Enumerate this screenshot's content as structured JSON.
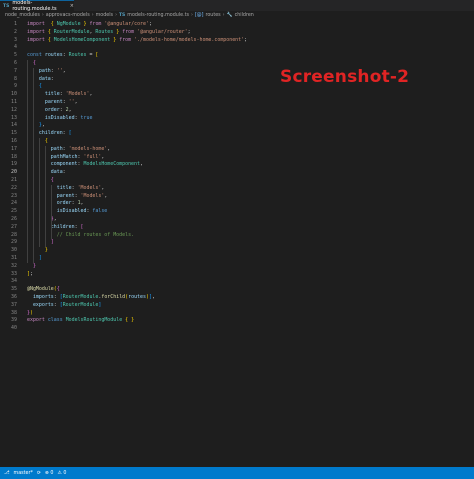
{
  "tab": {
    "icon": "TS",
    "filename": "models-routing.module.ts",
    "close": "×"
  },
  "breadcrumb": {
    "segments": [
      "node_modules",
      "approvacs-models",
      "models"
    ],
    "file_icon": "TS",
    "file": "models-routing.module.ts",
    "symbol_icon": "[@]",
    "symbol": "routes",
    "child_icon": "🔧",
    "child": "children",
    "separator": "›"
  },
  "watermark": "Screenshot-2",
  "editor": {
    "active_line": 20,
    "lines": [
      [
        [
          "kw",
          "import"
        ],
        [
          "",
          "  "
        ],
        [
          "b1",
          "{"
        ],
        [
          "",
          " "
        ],
        [
          "cls",
          "NgModule"
        ],
        [
          "",
          " "
        ],
        [
          "b1",
          "}"
        ],
        [
          "",
          " "
        ],
        [
          "kw",
          "from"
        ],
        [
          "",
          " "
        ],
        [
          "str",
          "'@angular/core'"
        ],
        [
          "",
          ";"
        ]
      ],
      [
        [
          "kw",
          "import"
        ],
        [
          "",
          " "
        ],
        [
          "b1",
          "{"
        ],
        [
          "",
          " "
        ],
        [
          "cls",
          "RouterModule"
        ],
        [
          "",
          ", "
        ],
        [
          "cls",
          "Routes"
        ],
        [
          "",
          " "
        ],
        [
          "b1",
          "}"
        ],
        [
          "",
          " "
        ],
        [
          "kw",
          "from"
        ],
        [
          "",
          " "
        ],
        [
          "str",
          "'@angular/router'"
        ],
        [
          "",
          ";"
        ]
      ],
      [
        [
          "kw",
          "import"
        ],
        [
          "",
          " "
        ],
        [
          "b1",
          "{"
        ],
        [
          "",
          " "
        ],
        [
          "cls",
          "ModelsHomeComponent"
        ],
        [
          "",
          " "
        ],
        [
          "b1",
          "}"
        ],
        [
          "",
          " "
        ],
        [
          "kw",
          "from"
        ],
        [
          "",
          " "
        ],
        [
          "str",
          "'./models-home/models-home.component'"
        ],
        [
          "",
          ";"
        ]
      ],
      [],
      [
        [
          "st",
          "const"
        ],
        [
          "",
          " "
        ],
        [
          "var",
          "routes"
        ],
        [
          "",
          ": "
        ],
        [
          "cls",
          "Routes"
        ],
        [
          "",
          " = "
        ],
        [
          "b1",
          "["
        ]
      ],
      [
        [
          "",
          "  "
        ],
        [
          "b2",
          "{"
        ]
      ],
      [
        [
          "",
          "    "
        ],
        [
          "var",
          "path"
        ],
        [
          "",
          ": "
        ],
        [
          "str",
          "''"
        ],
        [
          "",
          ","
        ]
      ],
      [
        [
          "",
          "    "
        ],
        [
          "var",
          "data"
        ],
        [
          "",
          ":"
        ]
      ],
      [
        [
          "",
          "    "
        ],
        [
          "b3",
          "{"
        ]
      ],
      [
        [
          "",
          "      "
        ],
        [
          "var",
          "title"
        ],
        [
          "",
          ": "
        ],
        [
          "str",
          "'Models'"
        ],
        [
          "",
          ","
        ]
      ],
      [
        [
          "",
          "      "
        ],
        [
          "var",
          "parent"
        ],
        [
          "",
          ": "
        ],
        [
          "str",
          "''"
        ],
        [
          "",
          ","
        ]
      ],
      [
        [
          "",
          "      "
        ],
        [
          "var",
          "order"
        ],
        [
          "",
          ": "
        ],
        [
          "num",
          "2"
        ],
        [
          "",
          ","
        ]
      ],
      [
        [
          "",
          "      "
        ],
        [
          "var",
          "isDisabled"
        ],
        [
          "",
          ": "
        ],
        [
          "st",
          "true"
        ]
      ],
      [
        [
          "",
          "    "
        ],
        [
          "b3",
          "}"
        ],
        [
          "",
          ","
        ]
      ],
      [
        [
          "",
          "    "
        ],
        [
          "var",
          "children"
        ],
        [
          "",
          ": "
        ],
        [
          "b3",
          "["
        ]
      ],
      [
        [
          "",
          "      "
        ],
        [
          "b1",
          "{"
        ]
      ],
      [
        [
          "",
          "        "
        ],
        [
          "var",
          "path"
        ],
        [
          "",
          ": "
        ],
        [
          "str",
          "'models-home'"
        ],
        [
          "",
          ","
        ]
      ],
      [
        [
          "",
          "        "
        ],
        [
          "var",
          "pathMatch"
        ],
        [
          "",
          ": "
        ],
        [
          "str",
          "'full'"
        ],
        [
          "",
          ","
        ]
      ],
      [
        [
          "",
          "        "
        ],
        [
          "var",
          "component"
        ],
        [
          "",
          ": "
        ],
        [
          "cls",
          "ModelsHomeComponent"
        ],
        [
          "",
          ","
        ]
      ],
      [
        [
          "",
          "        "
        ],
        [
          "var",
          "data"
        ],
        [
          "",
          ":"
        ]
      ],
      [
        [
          "",
          "        "
        ],
        [
          "b2",
          "{"
        ]
      ],
      [
        [
          "",
          "          "
        ],
        [
          "var",
          "title"
        ],
        [
          "",
          ": "
        ],
        [
          "str",
          "'Models'"
        ],
        [
          "",
          ","
        ]
      ],
      [
        [
          "",
          "          "
        ],
        [
          "var",
          "parent"
        ],
        [
          "",
          ": "
        ],
        [
          "str",
          "'Models'"
        ],
        [
          "",
          ","
        ]
      ],
      [
        [
          "",
          "          "
        ],
        [
          "var",
          "order"
        ],
        [
          "",
          ": "
        ],
        [
          "num",
          "1"
        ],
        [
          "",
          ","
        ]
      ],
      [
        [
          "",
          "          "
        ],
        [
          "var",
          "isDisabled"
        ],
        [
          "",
          ": "
        ],
        [
          "st",
          "false"
        ]
      ],
      [
        [
          "",
          "        "
        ],
        [
          "b2",
          "}"
        ],
        [
          "",
          ","
        ]
      ],
      [
        [
          "",
          "        "
        ],
        [
          "var",
          "children"
        ],
        [
          "",
          ": "
        ],
        [
          "b2",
          "["
        ]
      ],
      [
        [
          "",
          "          "
        ],
        [
          "cm",
          "// Child routes of Models."
        ]
      ],
      [
        [
          "",
          "        "
        ],
        [
          "b2",
          "]"
        ]
      ],
      [
        [
          "",
          "      "
        ],
        [
          "b1",
          "}"
        ]
      ],
      [
        [
          "",
          "    "
        ],
        [
          "b3",
          "]"
        ]
      ],
      [
        [
          "",
          "  "
        ],
        [
          "b2",
          "}"
        ]
      ],
      [
        [
          "b1",
          "]"
        ],
        [
          "",
          ";"
        ]
      ],
      [],
      [
        [
          "fn",
          "@"
        ],
        [
          "fn",
          "NgModule"
        ],
        [
          "b1",
          "("
        ],
        [
          "b2",
          "{"
        ]
      ],
      [
        [
          "",
          "  "
        ],
        [
          "var",
          "imports"
        ],
        [
          "",
          ": "
        ],
        [
          "b3",
          "["
        ],
        [
          "cls",
          "RouterModule"
        ],
        [
          "",
          "."
        ],
        [
          "fn",
          "forChild"
        ],
        [
          "b1",
          "("
        ],
        [
          "var",
          "routes"
        ],
        [
          "b1",
          ")"
        ],
        [
          "b3",
          "]"
        ],
        [
          "",
          ","
        ]
      ],
      [
        [
          "",
          "  "
        ],
        [
          "var",
          "exports"
        ],
        [
          "",
          ": "
        ],
        [
          "b3",
          "["
        ],
        [
          "cls",
          "RouterModule"
        ],
        [
          "b3",
          "]"
        ]
      ],
      [
        [
          "b2",
          "}"
        ],
        [
          "b1",
          ")"
        ]
      ],
      [
        [
          "kw",
          "export"
        ],
        [
          "",
          " "
        ],
        [
          "st",
          "class"
        ],
        [
          "",
          " "
        ],
        [
          "cls",
          "ModelsRoutingModule"
        ],
        [
          "",
          " "
        ],
        [
          "b1",
          "{"
        ],
        [
          "",
          " "
        ],
        [
          "b1",
          "}"
        ]
      ],
      []
    ]
  },
  "statusbar": {
    "branch_icon": "⎇",
    "branch": "master*",
    "sync": "⟳",
    "errors": "⊗ 0",
    "warnings": "⚠ 0"
  }
}
